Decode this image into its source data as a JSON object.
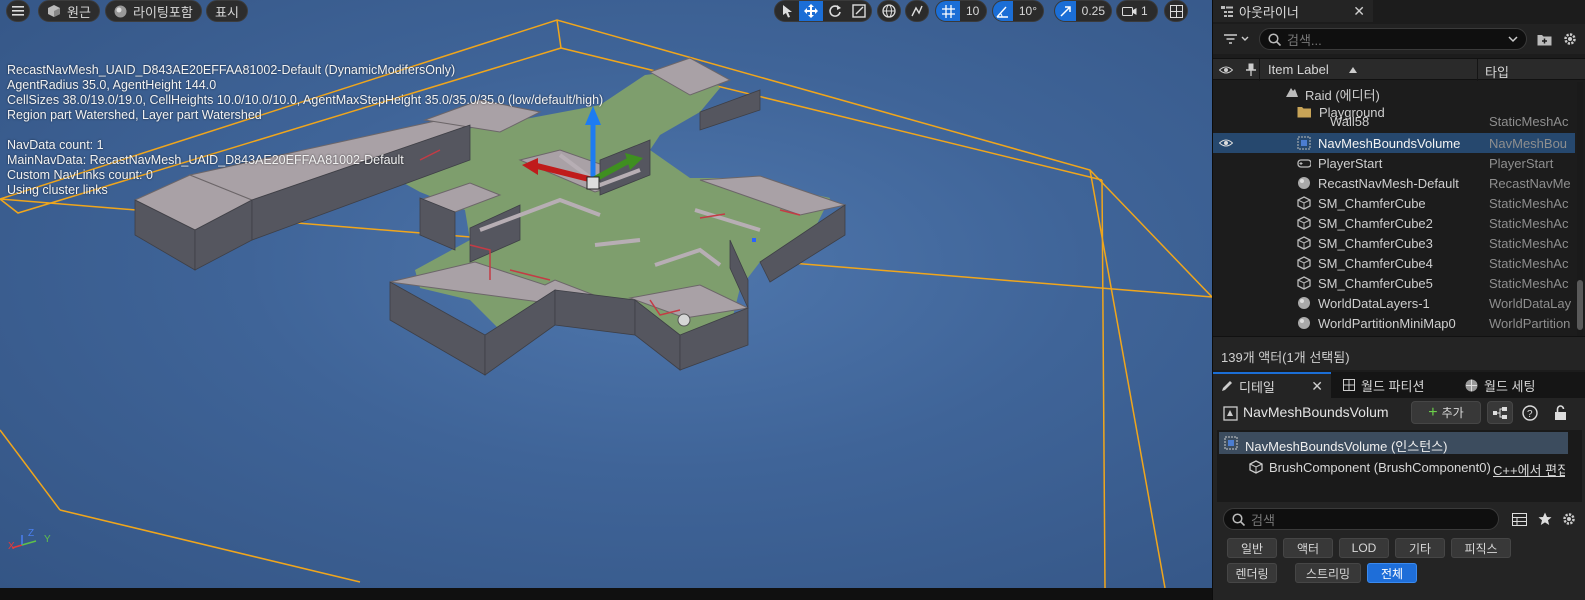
{
  "viewport": {
    "menu_icon": "hamburger-icon",
    "perspective_label": "원근",
    "lighting_label": "라이팅포함",
    "show_label": "표시",
    "grid_snap_value": "10",
    "rotation_snap_value": "10°",
    "scale_snap_value": "0.25",
    "camera_speed_value": "1",
    "nav_info": [
      "RecastNavMesh_UAID_D843AE20EFFAA81002-Default (DynamicModifersOnly)",
      "AgentRadius 35.0, AgentHeight 144.0",
      "CellSizes 38.0/19.0/19.0, CellHeights 10.0/10.0/10.0, AgentMaxStepHeight 35.0/35.0/35.0 (low/default/high)",
      "Region part Watershed, Layer part Watershed",
      "NavData count: 1",
      "MainNavData: RecastNavMesh_UAID_D843AE20EFFAA81002-Default",
      "Custom NavLinks count: 0",
      "Using cluster links"
    ],
    "axis_labels": {
      "x": "X",
      "y": "Y",
      "z": "Z"
    },
    "colors": {
      "bounds": "#f0a61c",
      "background": "#3f6498",
      "accent": "#1b6ed6"
    }
  },
  "outliner": {
    "tab_title": "아웃라이너",
    "search_placeholder": "검색...",
    "col_item_label": "Item Label",
    "col_type": "타입",
    "rows": [
      {
        "label": "Raid (에디터)",
        "type": ""
      },
      {
        "label": "Playground",
        "type": ""
      },
      {
        "label": "Wall58",
        "type": "StaticMeshAc"
      },
      {
        "label": "NavMeshBoundsVolume",
        "type": "NavMeshBou"
      },
      {
        "label": "PlayerStart",
        "type": "PlayerStart"
      },
      {
        "label": "RecastNavMesh-Default",
        "type": "RecastNavMe"
      },
      {
        "label": "SM_ChamferCube",
        "type": "StaticMeshAc"
      },
      {
        "label": "SM_ChamferCube2",
        "type": "StaticMeshAc"
      },
      {
        "label": "SM_ChamferCube3",
        "type": "StaticMeshAc"
      },
      {
        "label": "SM_ChamferCube4",
        "type": "StaticMeshAc"
      },
      {
        "label": "SM_ChamferCube5",
        "type": "StaticMeshAc"
      },
      {
        "label": "WorldDataLayers-1",
        "type": "WorldDataLay"
      },
      {
        "label": "WorldPartitionMiniMap0",
        "type": "WorldPartition"
      }
    ],
    "count_text": "139개 액터(1개 선택됨)"
  },
  "details": {
    "tabs": [
      "디테일",
      "월드 파티션",
      "월드 세팅"
    ],
    "object_name": "NavMeshBoundsVolum",
    "add_label": "추가",
    "instance_label": "NavMeshBoundsVolume (인스턴스)",
    "component_label": "BrushComponent (BrushComponent0)",
    "cpp_edit_label": "C++에서 편집",
    "search_placeholder": "검색",
    "filters": [
      "일반",
      "액터",
      "LOD",
      "기타",
      "피직스",
      "렌더링",
      "스트리밍",
      "전체"
    ],
    "active_filter": "전체"
  }
}
